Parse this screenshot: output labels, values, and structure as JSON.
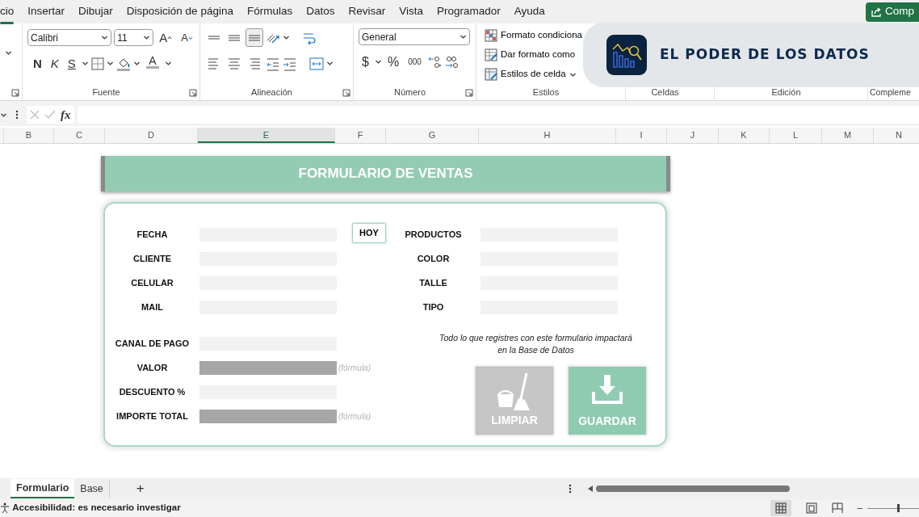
{
  "menu_tabs": [
    {
      "label": "cio",
      "selected": true
    },
    {
      "label": "Insertar",
      "selected": false
    },
    {
      "label": "Dibujar",
      "selected": false
    },
    {
      "label": "Disposición de página",
      "selected": false
    },
    {
      "label": "Fórmulas",
      "selected": false
    },
    {
      "label": "Datos",
      "selected": false
    },
    {
      "label": "Revisar",
      "selected": false
    },
    {
      "label": "Vista",
      "selected": false
    },
    {
      "label": "Programador",
      "selected": false
    },
    {
      "label": "Ayuda",
      "selected": false
    }
  ],
  "share_button": {
    "label": "Comp"
  },
  "ribbon": {
    "font_name": "Calibri",
    "font_size": "11",
    "grow_font": "A",
    "shrink_font": "A",
    "bold": "N",
    "italic": "K",
    "underline": "S",
    "font_color": "A",
    "number_format": "General",
    "currency": "$",
    "percent": "%",
    "thousands": "000",
    "styles": [
      {
        "label": "Formato condiciona",
        "kind": "conditional"
      },
      {
        "label": "Dar formato como",
        "kind": "table"
      },
      {
        "label": "Estilos de celda",
        "kind": "cell"
      }
    ],
    "groups": [
      {
        "label": "Fuente"
      },
      {
        "label": "Alineación"
      },
      {
        "label": "Número"
      },
      {
        "label": "Estilos"
      },
      {
        "label": "Celdas"
      },
      {
        "label": "Edición"
      },
      {
        "label": "Compleme"
      }
    ]
  },
  "banner": {
    "title": "EL PODER DE LOS DATOS"
  },
  "formula_bar": {
    "function_label": "fx"
  },
  "columns": [
    {
      "label": "B",
      "selected": false
    },
    {
      "label": "C",
      "selected": false
    },
    {
      "label": "D",
      "selected": false
    },
    {
      "label": "E",
      "selected": true
    },
    {
      "label": "F",
      "selected": false
    },
    {
      "label": "G",
      "selected": false
    },
    {
      "label": "H",
      "selected": false
    },
    {
      "label": "I",
      "selected": false
    },
    {
      "label": "J",
      "selected": false
    },
    {
      "label": "K",
      "selected": false
    },
    {
      "label": "L",
      "selected": false
    },
    {
      "label": "M",
      "selected": false
    },
    {
      "label": "N",
      "selected": false
    }
  ],
  "form": {
    "title": "FORMULARIO DE VENTAS",
    "today_button": "HOY",
    "left_fields": [
      {
        "label": "FECHA",
        "kind": "input"
      },
      {
        "label": "CLIENTE",
        "kind": "input"
      },
      {
        "label": "CELULAR",
        "kind": "input"
      },
      {
        "label": "MAIL",
        "kind": "input"
      },
      {
        "label": "CANAL DE PAGO",
        "kind": "input"
      },
      {
        "label": "VALOR",
        "kind": "formula",
        "hint": "(fórmula)"
      },
      {
        "label": "DESCUENTO %",
        "kind": "input"
      },
      {
        "label": "IMPORTE TOTAL",
        "kind": "formula",
        "hint": "(fórmula)"
      }
    ],
    "right_fields": [
      {
        "label": "PRODUCTOS",
        "kind": "input"
      },
      {
        "label": "COLOR",
        "kind": "input"
      },
      {
        "label": "TALLE",
        "kind": "input"
      },
      {
        "label": "TIPO",
        "kind": "input"
      }
    ],
    "note": "Todo lo que registres con este formulario impactará\nen la Base de Datos",
    "buttons": [
      {
        "label": "LIMPIAR",
        "kind": "clear",
        "disabled": true
      },
      {
        "label": "GUARDAR",
        "kind": "save",
        "disabled": false
      }
    ]
  },
  "sheet_tabs": [
    {
      "label": "Formulario",
      "selected": true
    },
    {
      "label": "Base",
      "selected": false
    }
  ],
  "new_sheet": "+",
  "status_bar": {
    "text": "Accesibilidad: es necesario investigar",
    "zoom_out": "–",
    "zoom_slider": {
      "level": 0.6
    }
  }
}
